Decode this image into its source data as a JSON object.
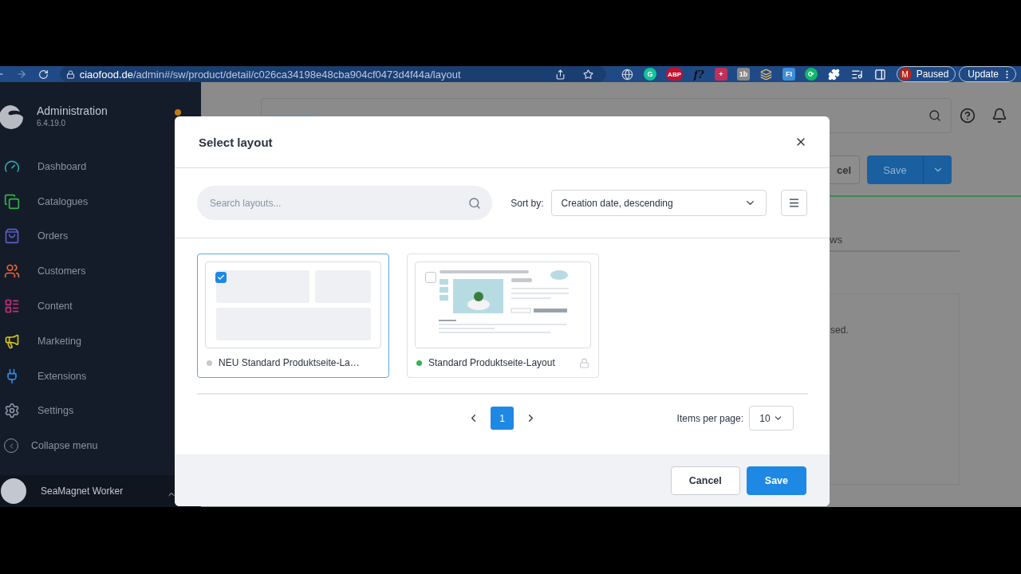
{
  "browser": {
    "url_host": "ciaofood.de",
    "url_path": "/admin#/sw/product/detail/c026ca34198e48cba904cf0473d4f44a/layout",
    "extensions": [
      {
        "kind": "globe"
      },
      {
        "kind": "circle",
        "color": "#15c39a",
        "label": "G"
      },
      {
        "kind": "circle",
        "color": "#c8102e",
        "label": "ABP"
      },
      {
        "kind": "text",
        "label": "f?"
      },
      {
        "kind": "square",
        "color": "#c0305a",
        "label": "+"
      },
      {
        "kind": "square",
        "color": "#888888",
        "label": "1b"
      },
      {
        "kind": "stack"
      },
      {
        "kind": "square",
        "color": "#3d8fd8",
        "label": "FI"
      },
      {
        "kind": "circle",
        "color": "#12b76a",
        "label": "⟳"
      },
      {
        "kind": "puzzle"
      },
      {
        "kind": "playlist"
      },
      {
        "kind": "panel"
      }
    ],
    "profile": {
      "initial": "M",
      "label": "Paused"
    },
    "update": "Update"
  },
  "sidebar": {
    "title": "Administration",
    "version": "6.4.19.0",
    "items": [
      {
        "label": "Dashboard",
        "kind": "dashboard",
        "color": "#2ea5a5"
      },
      {
        "label": "Catalogues",
        "kind": "catalogues",
        "color": "#37b24d"
      },
      {
        "label": "Orders",
        "kind": "orders",
        "color": "#5c5fc8"
      },
      {
        "label": "Customers",
        "kind": "customers",
        "color": "#e8643a"
      },
      {
        "label": "Content",
        "kind": "content",
        "color": "#c6307e"
      },
      {
        "label": "Marketing",
        "kind": "marketing",
        "color": "#d6c21a"
      },
      {
        "label": "Extensions",
        "kind": "extensions",
        "color": "#2f8ae0"
      },
      {
        "label": "Settings",
        "kind": "settings",
        "color": "#8a95a5"
      }
    ],
    "collapse": "Collapse menu",
    "user": "SeaMagnet Worker"
  },
  "background": {
    "cancel_fragment": "cel",
    "save": "Save",
    "tab_fragment": "ws",
    "text_fragment": "sed."
  },
  "modal": {
    "title": "Select layout",
    "search": {
      "placeholder": "Search layouts..."
    },
    "sort_label": "Sort by:",
    "sort_value": "Creation date, descending",
    "layouts": [
      {
        "name": "NEU Standard Produktseite-La…",
        "kind": "blank",
        "selected": true,
        "color": "#c4c9cf",
        "locked": false
      },
      {
        "name": "Standard Produktseite-Layout",
        "kind": "product",
        "selected": false,
        "color": "#37b24d",
        "locked": true
      }
    ],
    "pages": [
      {
        "label": "1",
        "selected": true
      }
    ],
    "items_per_page_label": "Items per page:",
    "items_per_page": "10",
    "buttons": [
      {
        "label": "Cancel",
        "kind": "secondary"
      },
      {
        "label": "Save",
        "kind": "primary"
      }
    ]
  }
}
